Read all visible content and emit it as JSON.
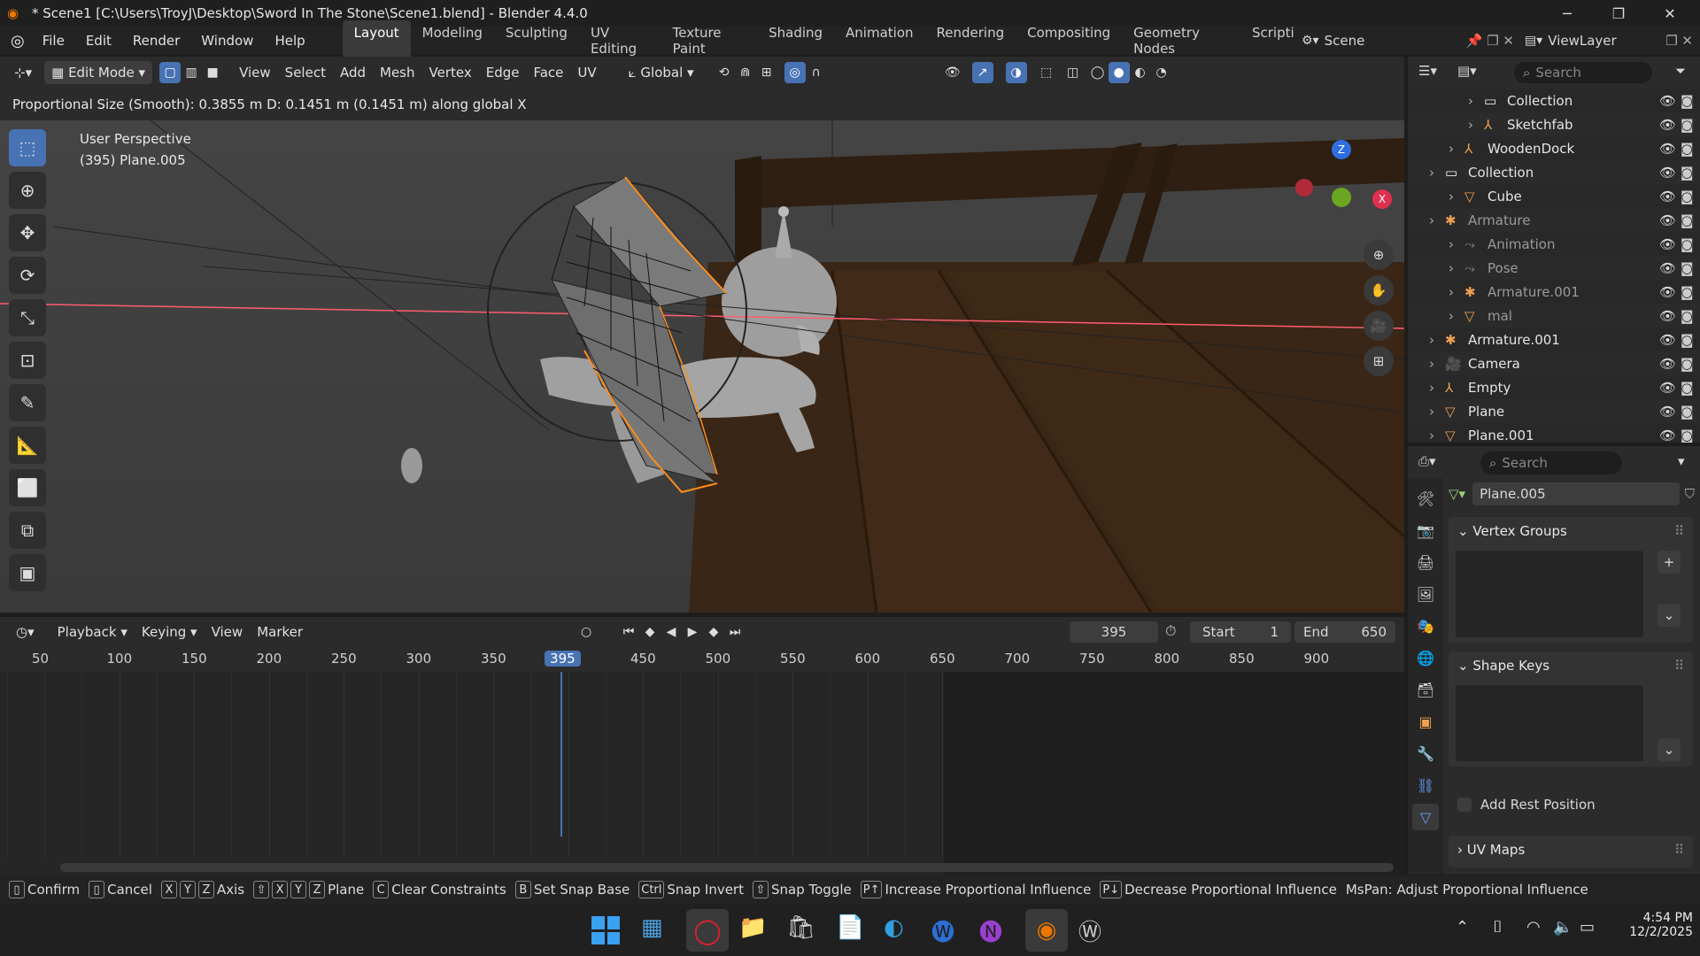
{
  "window": {
    "title": "* Scene1 [C:\\Users\\TroyJ\\Desktop\\Sword In The Stone\\Scene1.blend] - Blender 4.4.0",
    "minimize": "─",
    "maximize": "❐",
    "close": "✕"
  },
  "menu": [
    "File",
    "Edit",
    "Render",
    "Window",
    "Help"
  ],
  "workspaces": [
    "Layout",
    "Modeling",
    "Sculpting",
    "UV Editing",
    "Texture Paint",
    "Shading",
    "Animation",
    "Rendering",
    "Compositing",
    "Geometry Nodes",
    "Scripti"
  ],
  "scene": "Scene",
  "view_layer": "ViewLayer",
  "viewport_header": {
    "mode": "Edit Mode",
    "menus": [
      "View",
      "Select",
      "Add",
      "Mesh",
      "Vertex",
      "Edge",
      "Face",
      "UV"
    ],
    "orientation": "Global"
  },
  "operator_status": "Proportional Size (Smooth): 0.3855 m   D: 0.1451 m (0.1451 m) along global X",
  "viewport": {
    "perspective": "User Perspective",
    "object_info": "(395) Plane.005",
    "gizmo": {
      "z": "Z",
      "x": "X"
    }
  },
  "timeline": {
    "menus": [
      "Playback",
      "Keying",
      "View",
      "Marker"
    ],
    "current_frame": "395",
    "start_label": "Start",
    "start_value": "1",
    "end_label": "End",
    "end_value": "650",
    "ruler": [
      "50",
      "100",
      "150",
      "200",
      "250",
      "300",
      "350",
      "395",
      "450",
      "500",
      "550",
      "600",
      "650",
      "700",
      "750",
      "800",
      "850",
      "900"
    ]
  },
  "outliner": {
    "search_placeholder": "Search",
    "items": [
      {
        "label": "Collection",
        "indent": 3,
        "type": "collection"
      },
      {
        "label": "Sketchfab",
        "indent": 3,
        "type": "empty"
      },
      {
        "label": "WoodenDock",
        "indent": 2,
        "type": "empty"
      },
      {
        "label": "Collection",
        "indent": 1,
        "type": "collection"
      },
      {
        "label": "Cube",
        "indent": 2,
        "type": "mesh"
      },
      {
        "label": "Armature",
        "indent": 1,
        "type": "armature"
      },
      {
        "label": "Animation",
        "indent": 2,
        "type": "anim"
      },
      {
        "label": "Pose",
        "indent": 2,
        "type": "pose"
      },
      {
        "label": "Armature.001",
        "indent": 2,
        "type": "armature"
      },
      {
        "label": "mal",
        "indent": 2,
        "type": "mesh"
      },
      {
        "label": "Armature.001",
        "indent": 1,
        "type": "armature"
      },
      {
        "label": "Camera",
        "indent": 1,
        "type": "camera"
      },
      {
        "label": "Empty",
        "indent": 1,
        "type": "empty"
      },
      {
        "label": "Plane",
        "indent": 1,
        "type": "mesh"
      },
      {
        "label": "Plane.001",
        "indent": 1,
        "type": "mesh"
      }
    ]
  },
  "properties": {
    "search_placeholder": "Search",
    "object_name": "Plane.005",
    "vertex_groups": "Vertex Groups",
    "shape_keys": "Shape Keys",
    "add_rest_position": "Add Rest Position",
    "uv_maps": "UV Maps"
  },
  "statusbar": [
    {
      "keys": [],
      "label": "Confirm"
    },
    {
      "keys": [],
      "label": "Cancel"
    },
    {
      "keys": [
        "X",
        "Y",
        "Z"
      ],
      "label": "Axis"
    },
    {
      "keys": [
        "⇧",
        "X",
        "Y",
        "Z"
      ],
      "label": "Plane"
    },
    {
      "keys": [
        "C"
      ],
      "label": "Clear Constraints"
    },
    {
      "keys": [
        "B"
      ],
      "label": "Set Snap Base"
    },
    {
      "keys": [
        "Ctrl"
      ],
      "label": "Snap Invert"
    },
    {
      "keys": [
        "⇧"
      ],
      "label": "Snap Toggle"
    },
    {
      "keys": [
        "P↑"
      ],
      "label": "Increase Proportional Influence"
    },
    {
      "keys": [
        "P↓"
      ],
      "label": "Decrease Proportional Influence"
    },
    {
      "keys": [],
      "label": "MsPan: Adjust Proportional Influence"
    }
  ],
  "taskbar": {
    "time": "4:54 PM",
    "date": "12/2/2025"
  },
  "colors": {
    "accent": "#4772b3",
    "selection": "#ff8c1a",
    "x_axis": "#ff3352"
  }
}
